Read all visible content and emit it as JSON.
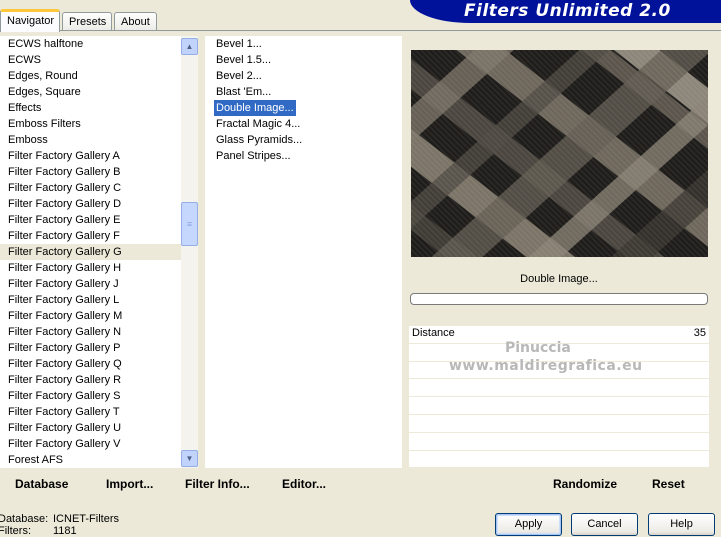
{
  "tabs": [
    {
      "label": "Navigator",
      "active": true
    },
    {
      "label": "Presets",
      "active": false
    },
    {
      "label": "About",
      "active": false
    }
  ],
  "title": "Filters Unlimited 2.0",
  "categories": [
    "ECWS halftone",
    "ECWS",
    "Edges, Round",
    "Edges, Square",
    "Effects",
    "Emboss Filters",
    "Emboss",
    "Filter Factory Gallery A",
    "Filter Factory Gallery B",
    "Filter Factory Gallery C",
    "Filter Factory Gallery D",
    "Filter Factory Gallery E",
    "Filter Factory Gallery F",
    "Filter Factory Gallery G",
    "Filter Factory Gallery H",
    "Filter Factory Gallery J",
    "Filter Factory Gallery L",
    "Filter Factory Gallery M",
    "Filter Factory Gallery N",
    "Filter Factory Gallery P",
    "Filter Factory Gallery Q",
    "Filter Factory Gallery R",
    "Filter Factory Gallery S",
    "Filter Factory Gallery T",
    "Filter Factory Gallery U",
    "Filter Factory Gallery V",
    "Forest AFS"
  ],
  "selected_category": "Filter Factory Gallery G",
  "filters": [
    "Bevel 1...",
    "Bevel 1.5...",
    "Bevel 2...",
    "Blast 'Em...",
    "Double Image...",
    "Fractal Magic 4...",
    "Glass Pyramids...",
    "Panel Stripes..."
  ],
  "selected_filter": "Double Image...",
  "preview": {
    "filter_name": "Double Image..."
  },
  "params": [
    {
      "label": "Distance",
      "value": "35"
    }
  ],
  "watermark": {
    "line1": "Pinuccia",
    "line2": "www.maldiregrafica.eu"
  },
  "bottom_links": {
    "database": "Database",
    "import": "Import...",
    "filter_info": "Filter Info...",
    "editor": "Editor...",
    "randomize": "Randomize",
    "reset": "Reset"
  },
  "status": {
    "database_label": "Database:",
    "database_value": "ICNET-Filters",
    "filters_label": "Filters:",
    "filters_value": "1181"
  },
  "buttons": {
    "apply": "Apply",
    "cancel": "Cancel",
    "help": "Help"
  },
  "icons": {
    "scroll_up": "chevron-up-icon",
    "scroll_down": "chevron-down-icon",
    "scroll_grip": "grip-icon"
  },
  "colors": {
    "banner": "#00129a",
    "selection": "#316ac5",
    "face": "#ece9d8"
  }
}
